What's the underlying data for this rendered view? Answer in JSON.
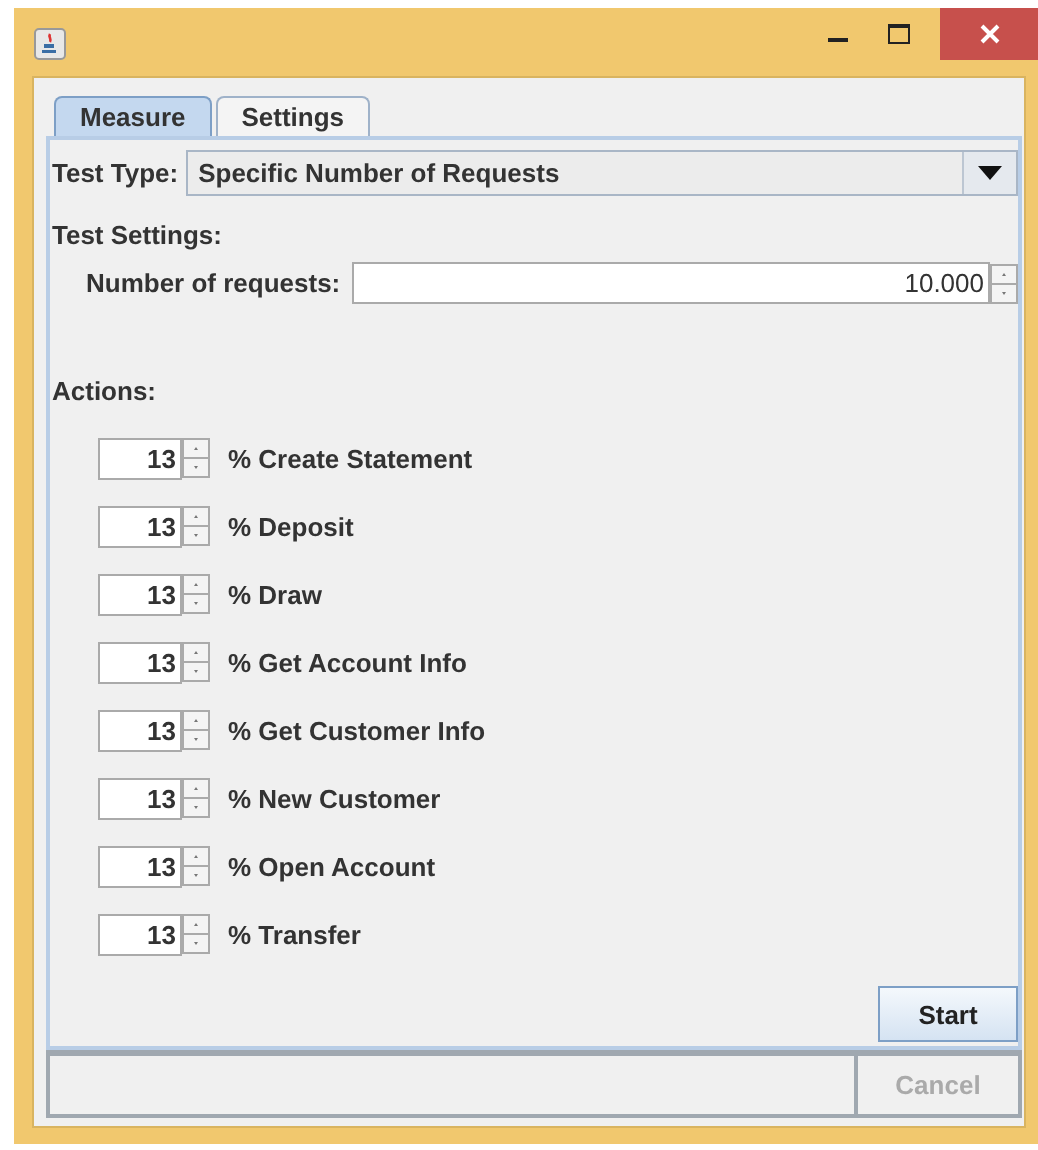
{
  "tabs": [
    {
      "label": "Measure",
      "selected": true
    },
    {
      "label": "Settings",
      "selected": false
    }
  ],
  "test_type": {
    "label": "Test Type:",
    "value": "Specific Number of Requests"
  },
  "test_settings": {
    "heading": "Test Settings:",
    "requests_label": "Number of requests:",
    "requests_value": "10.000"
  },
  "actions": {
    "heading": "Actions:",
    "items": [
      {
        "value": "13",
        "label": "% Create Statement"
      },
      {
        "value": "13",
        "label": "% Deposit"
      },
      {
        "value": "13",
        "label": "% Draw"
      },
      {
        "value": "13",
        "label": "% Get Account Info"
      },
      {
        "value": "13",
        "label": "% Get Customer Info"
      },
      {
        "value": "13",
        "label": "% New Customer"
      },
      {
        "value": "13",
        "label": "% Open Account"
      },
      {
        "value": "13",
        "label": "% Transfer"
      }
    ]
  },
  "buttons": [
    {
      "label": "Start",
      "disabled": false
    }
  ],
  "status_bar": {
    "cancel": {
      "label": "Cancel",
      "disabled": true
    }
  }
}
